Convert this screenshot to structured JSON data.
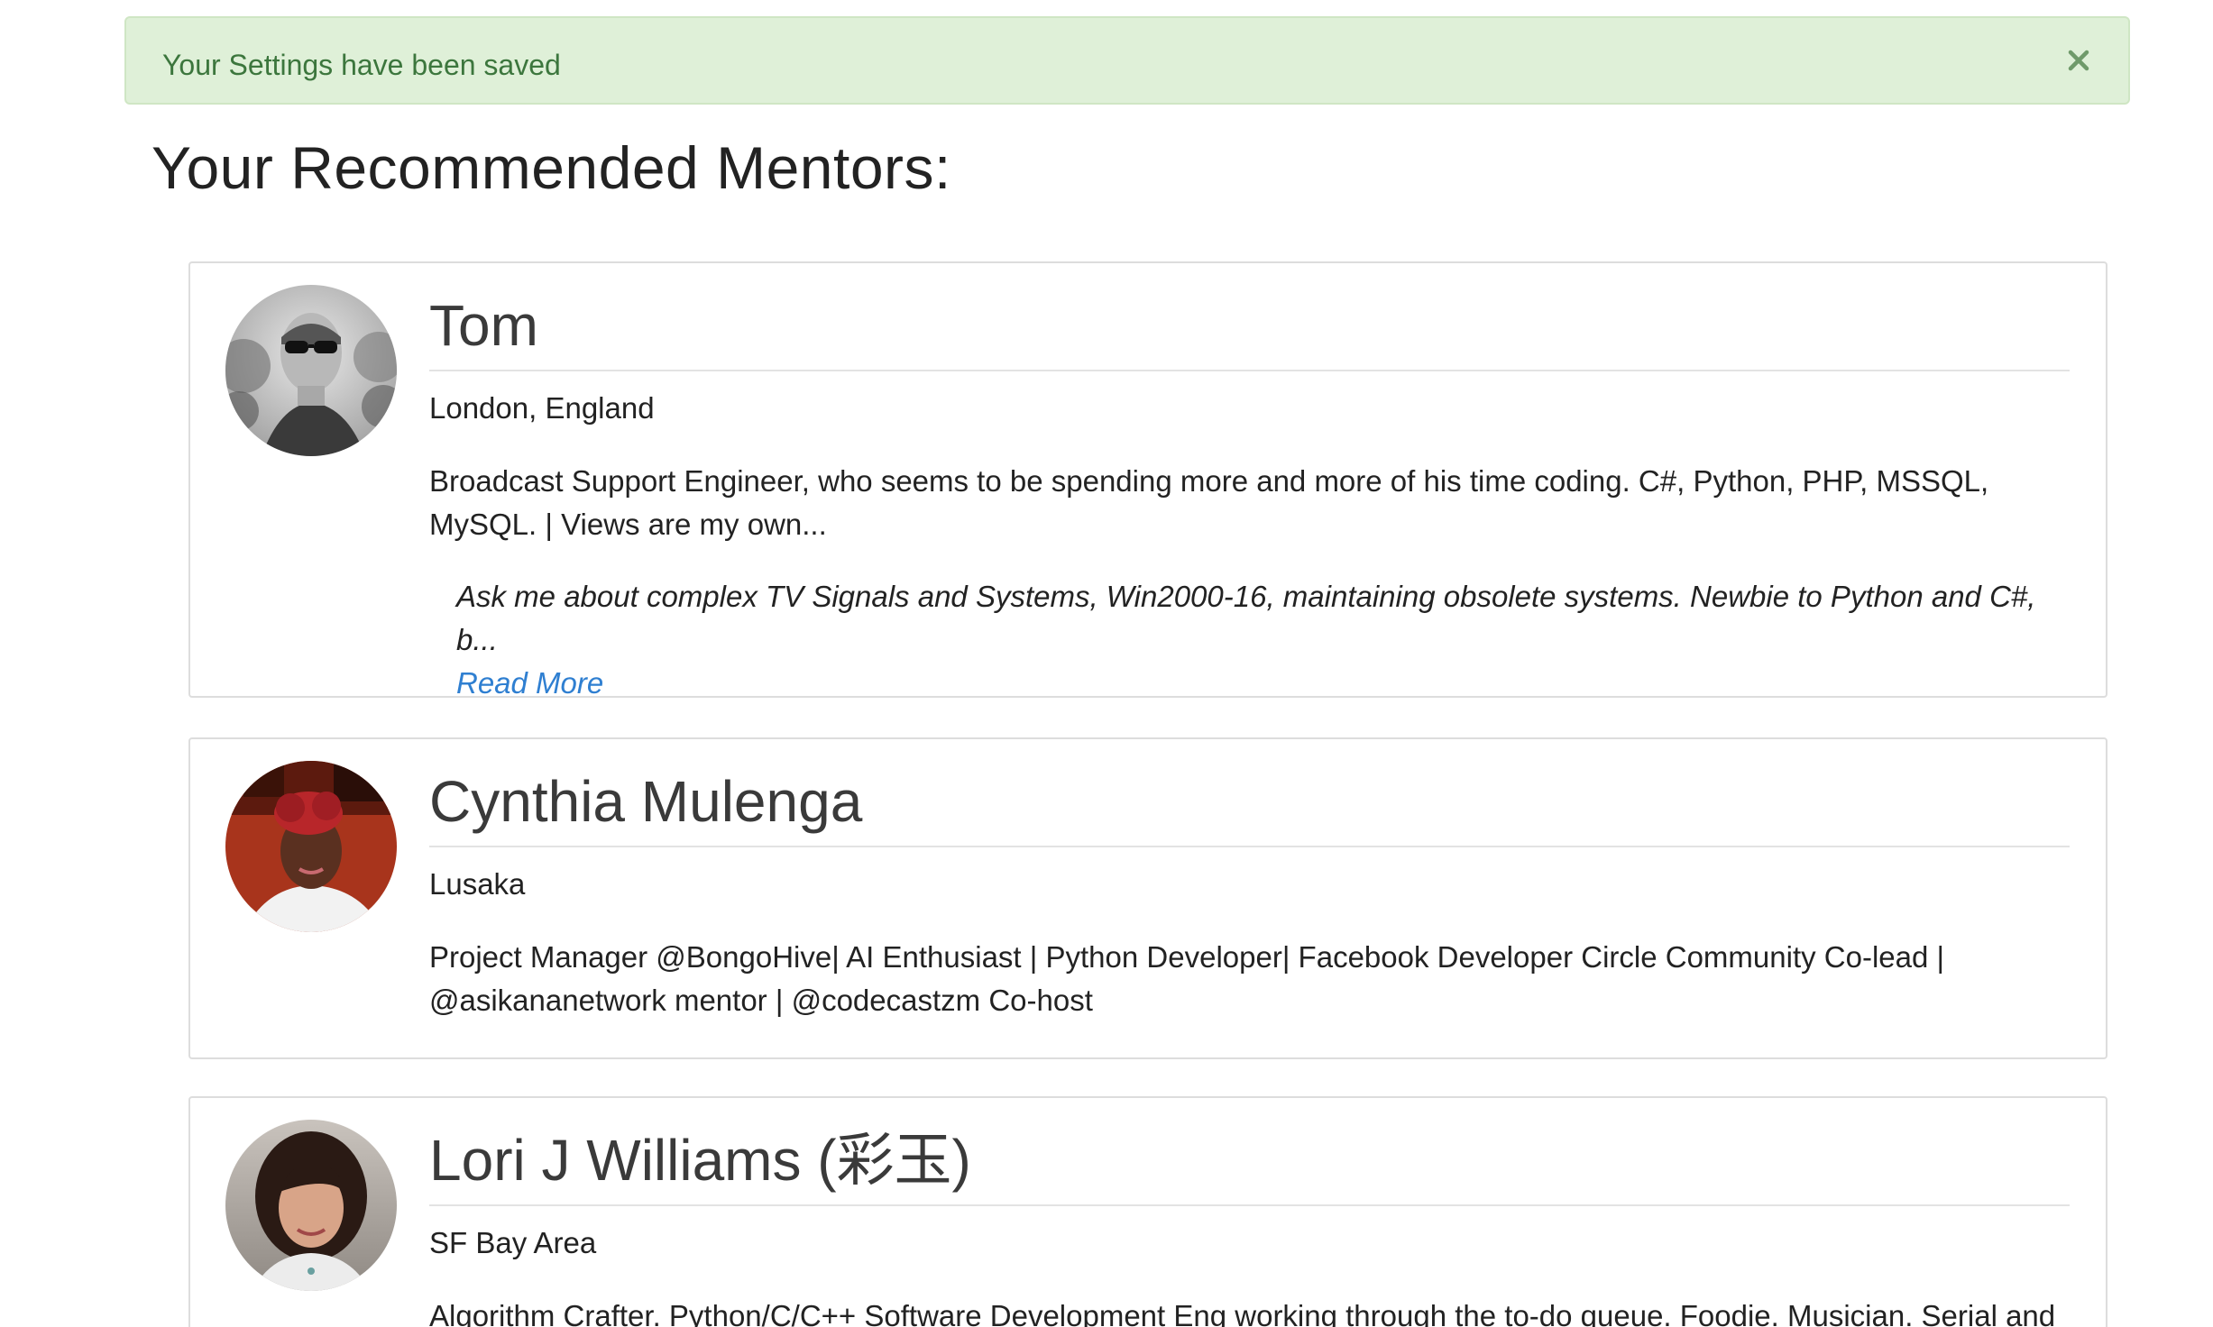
{
  "alert": {
    "message": "Your Settings have been saved",
    "close_label": "×"
  },
  "page": {
    "title": "Your Recommended Mentors:"
  },
  "mentors": [
    {
      "name": "Tom",
      "location": "London, England",
      "bio": "Broadcast Support Engineer, who seems to be spending more and more of his time coding. C#, Python, PHP, MSSQL, MySQL. | Views are my own...",
      "ask": "Ask me about complex TV Signals and Systems, Win2000-16, maintaining obsolete systems. Newbie to Python and C#, b...",
      "read_more": "Read More"
    },
    {
      "name": "Cynthia Mulenga",
      "location": "Lusaka",
      "bio": "Project Manager @BongoHive| AI Enthusiast | Python Developer| Facebook Developer Circle Community Co-lead | @asikananetwork mentor | @codecastzm Co-host"
    },
    {
      "name": "Lori J Williams (彩玉)",
      "location": "SF Bay Area",
      "bio": "Algorithm Crafter. Python/C/C++ Software Development Eng working through the to-do queue. Foodie. Musician. Serial and"
    }
  ],
  "colors": {
    "alert_bg": "#dff0d8",
    "alert_text": "#3c763d",
    "link": "#2f7fd1",
    "card_border": "#dddddd"
  }
}
